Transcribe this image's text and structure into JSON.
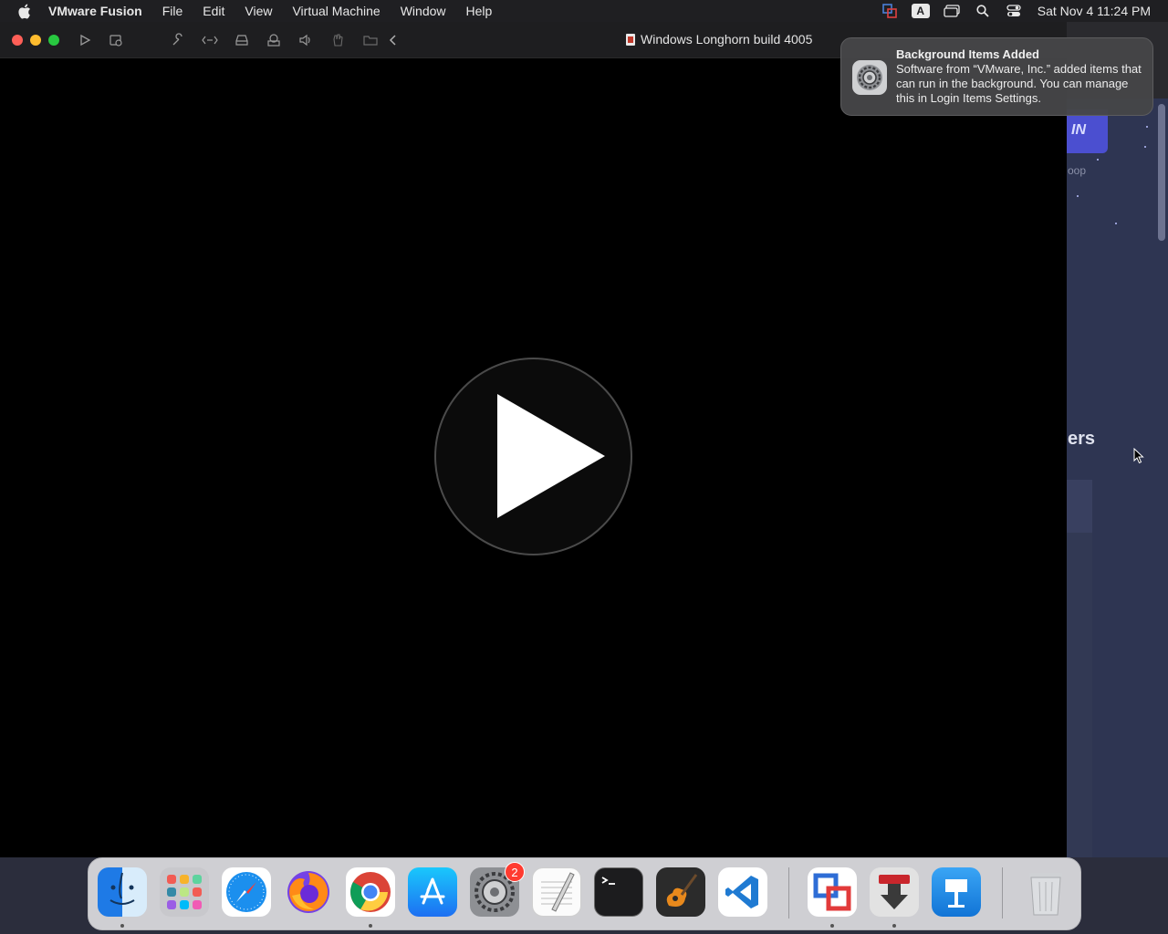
{
  "menubar": {
    "app_name": "VMware Fusion",
    "items": [
      "File",
      "Edit",
      "View",
      "Virtual Machine",
      "Window",
      "Help"
    ],
    "status_icons": [
      "vmware-status-icon",
      "input-source-icon",
      "screen-mirroring-icon",
      "spotlight-search-icon",
      "control-center-icon"
    ],
    "input_source_letter": "A",
    "clock": "Sat Nov 4  11:24 PM"
  },
  "vm_window": {
    "title": "Windows Longhorn build 4005",
    "toolbar_icons": [
      "play-icon",
      "snapshot-icon",
      "settings-wrench-icon",
      "network-icon",
      "hard-disk-icon",
      "printer-icon",
      "sound-icon",
      "usb-hand-icon",
      "folder-share-icon",
      "collapse-chevron-icon"
    ]
  },
  "notification": {
    "title": "Background Items Added",
    "body": "Software from “VMware, Inc.” added items that can run in the background. You can manage this in Login Items Settings.",
    "icon": "system-settings-gear-icon"
  },
  "background_window": {
    "button_text": "IN",
    "small_text": "oop",
    "heading_text": "ers"
  },
  "dock": {
    "items": [
      {
        "name": "Finder",
        "icon": "finder-icon",
        "running": true
      },
      {
        "name": "Launchpad",
        "icon": "launchpad-icon",
        "running": false
      },
      {
        "name": "Safari",
        "icon": "safari-icon",
        "running": false
      },
      {
        "name": "Firefox",
        "icon": "firefox-icon",
        "running": false
      },
      {
        "name": "Google Chrome",
        "icon": "chrome-icon",
        "running": true
      },
      {
        "name": "App Store",
        "icon": "app-store-icon",
        "running": false
      },
      {
        "name": "System Settings",
        "icon": "system-settings-icon",
        "running": false,
        "badge": "2"
      },
      {
        "name": "TextEdit",
        "icon": "textedit-icon",
        "running": false
      },
      {
        "name": "Terminal",
        "icon": "terminal-icon",
        "running": false
      },
      {
        "name": "GarageBand",
        "icon": "garageband-icon",
        "running": false
      },
      {
        "name": "Visual Studio Code",
        "icon": "vscode-icon",
        "running": false
      },
      {
        "name": "VMware Fusion",
        "icon": "vmware-fusion-icon",
        "running": true
      },
      {
        "name": "Transmission",
        "icon": "transmission-icon",
        "running": true
      },
      {
        "name": "Keynote",
        "icon": "keynote-icon",
        "running": false
      },
      {
        "name": "Trash",
        "icon": "trash-icon",
        "running": false
      }
    ]
  }
}
